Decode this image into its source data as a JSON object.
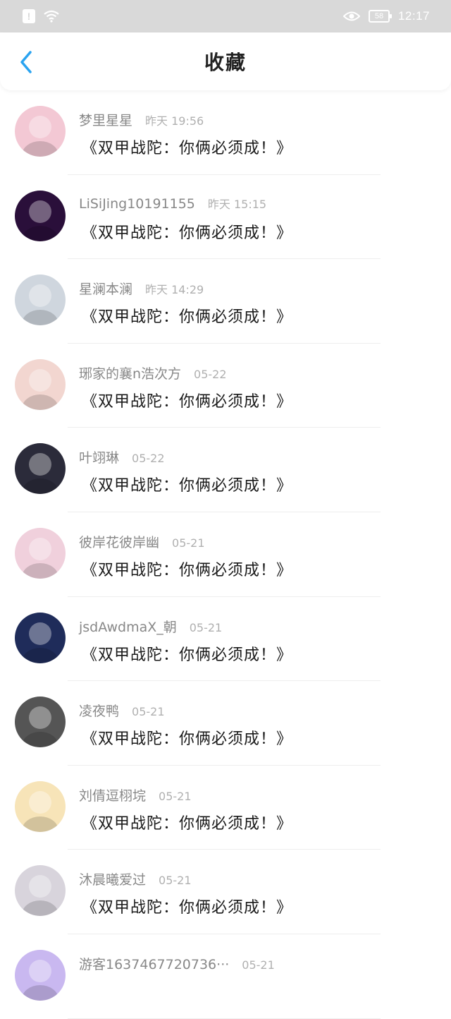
{
  "status_bar": {
    "time": "12:17",
    "battery": "58",
    "icons": [
      "notification-icon",
      "wifi-icon",
      "eye-icon",
      "battery-icon"
    ]
  },
  "header": {
    "title": "收藏",
    "back_icon": "chevron-left-icon"
  },
  "colors": {
    "accent": "#2aa3f0",
    "status_bar_bg": "#d9d9d9",
    "username": "#888888",
    "time": "#b0b0b0"
  },
  "items": [
    {
      "username": "梦里星星",
      "time": "昨天 19:56",
      "content": "《双甲战陀：你俩必须成！》",
      "avatar_color": "#f3c8d4"
    },
    {
      "username": "LiSiJing10191155",
      "time": "昨天 15:15",
      "content": "《双甲战陀：你俩必须成！》",
      "avatar_color": "#2a0f3a"
    },
    {
      "username": "星澜本澜",
      "time": "昨天 14:29",
      "content": "《双甲战陀：你俩必须成！》",
      "avatar_color": "#cfd6de"
    },
    {
      "username": "琊家的襄n浩次方",
      "time": "05-22",
      "content": "《双甲战陀：你俩必须成！》",
      "avatar_color": "#f2d6d0"
    },
    {
      "username": "叶翊琳",
      "time": "05-22",
      "content": "《双甲战陀：你俩必须成！》",
      "avatar_color": "#2b2b3a"
    },
    {
      "username": "彼岸花彼岸幽",
      "time": "05-21",
      "content": "《双甲战陀：你俩必须成！》",
      "avatar_color": "#f0d0dc"
    },
    {
      "username": "jsdAwdmaX_朝",
      "time": "05-21",
      "content": "《双甲战陀：你俩必须成！》",
      "avatar_color": "#1f2c5a"
    },
    {
      "username": "凌夜鸭",
      "time": "05-21",
      "content": "《双甲战陀：你俩必须成！》",
      "avatar_color": "#555555"
    },
    {
      "username": "刘倩逗栩垸",
      "time": "05-21",
      "content": "《双甲战陀：你俩必须成！》",
      "avatar_color": "#f7e4b8"
    },
    {
      "username": "沐晨曦爱过",
      "time": "05-21",
      "content": "《双甲战陀：你俩必须成！》",
      "avatar_color": "#d8d4dc"
    },
    {
      "username": "游客1637467720736···",
      "time": "05-21",
      "content": "",
      "avatar_color": "#c9b8f0"
    }
  ]
}
